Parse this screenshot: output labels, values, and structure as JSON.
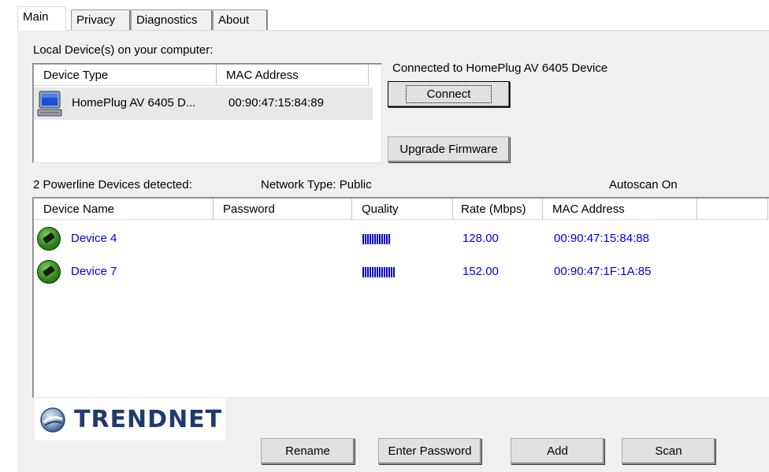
{
  "tabs": [
    {
      "label": "Main",
      "active": true
    },
    {
      "label": "Privacy",
      "active": false
    },
    {
      "label": "Diagnostics",
      "active": false
    },
    {
      "label": "About",
      "active": false
    }
  ],
  "local": {
    "heading": "Local Device(s) on your computer:",
    "columns": [
      "Device Type",
      "MAC Address"
    ],
    "rows": [
      {
        "device_type": "HomePlug AV 6405 D...",
        "mac": "00:90:47:15:84:89",
        "icon": "computer-icon"
      }
    ]
  },
  "connection": {
    "status": "Connected to HomePlug AV 6405 Device",
    "connect_label": "Connect",
    "upgrade_label": "Upgrade Firmware"
  },
  "powerline": {
    "detected_text": "2 Powerline Devices detected:",
    "network_type": "Network Type: Public",
    "autoscan": "Autoscan On",
    "columns": [
      "Device Name",
      "Password",
      "Quality",
      "Rate (Mbps)",
      "MAC Address"
    ],
    "rows": [
      {
        "name": "Device 4",
        "password": "",
        "quality_bars": 12,
        "rate": "128.00",
        "mac": "00:90:47:15:84:88",
        "icon": "powerline-device-icon"
      },
      {
        "name": "Device 7",
        "password": "",
        "quality_bars": 14,
        "rate": "152.00",
        "mac": "00:90:47:1F:1A:85",
        "icon": "powerline-device-icon"
      }
    ],
    "row_color": "#0000e6"
  },
  "logo": {
    "text": "TRENDNET",
    "brand_color": "#1f3b6e"
  },
  "buttons": {
    "rename": "Rename",
    "enter_password": "Enter Password",
    "add": "Add",
    "scan": "Scan"
  }
}
